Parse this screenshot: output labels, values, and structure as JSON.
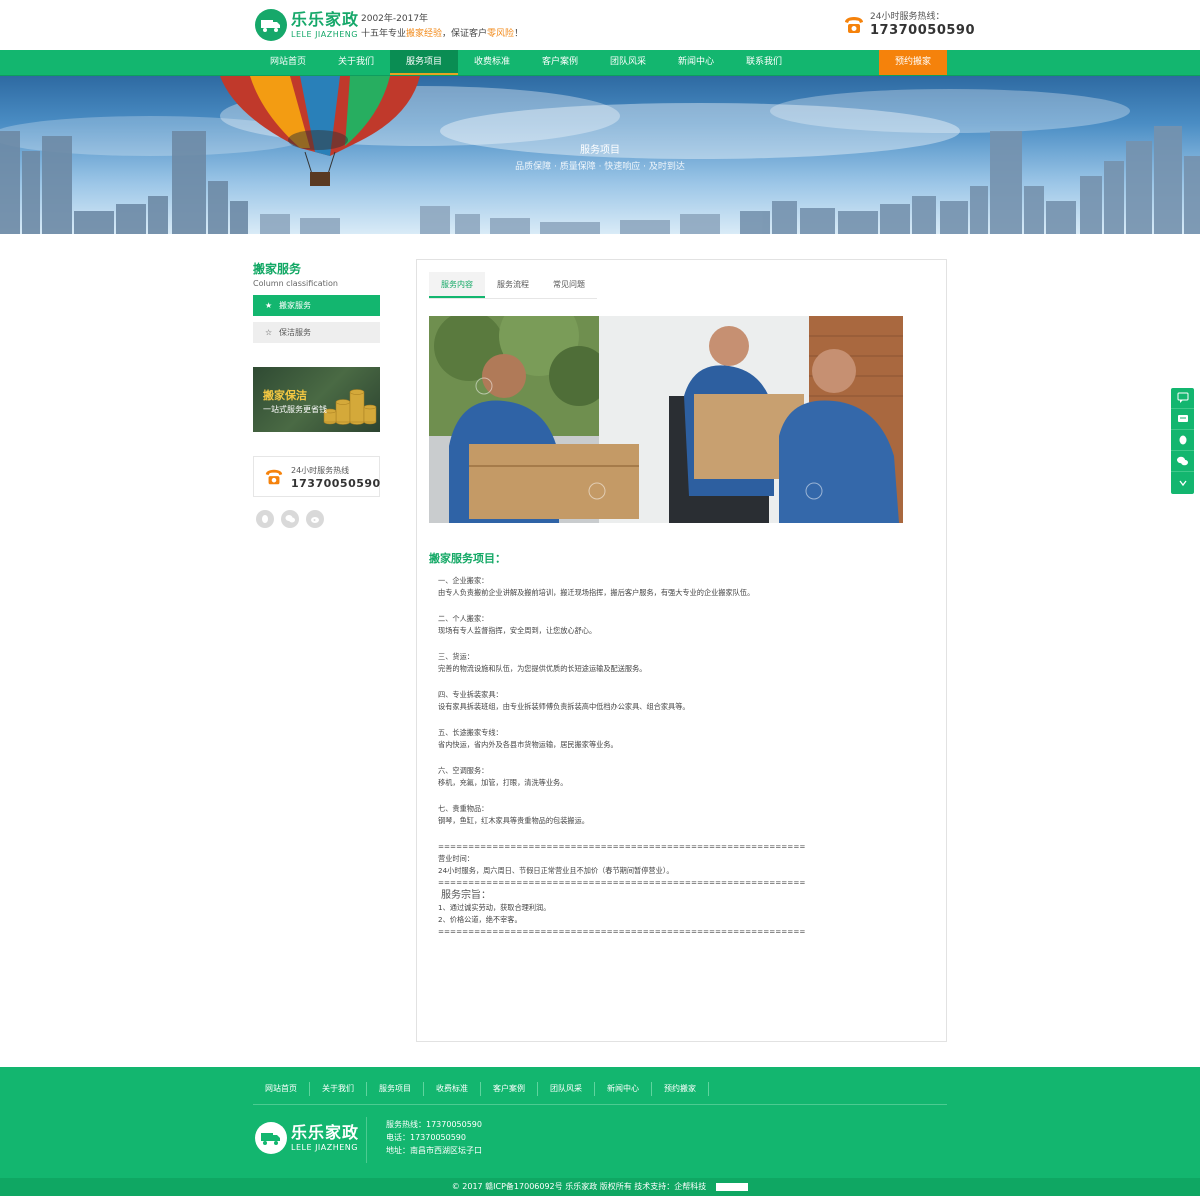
{
  "brand": {
    "name_cn": "乐乐家政",
    "name_en": "LELE JIAZHENG",
    "years": "2002年-2017年",
    "slogan_prefix": "十五年专业",
    "slogan_hl1": "搬家经验",
    "slogan_mid": "，保证客户",
    "slogan_hl2": "零风险",
    "slogan_end": "！"
  },
  "hotline": {
    "label": "24小时服务热线：",
    "number": "17370050590"
  },
  "nav": {
    "items": [
      "网站首页",
      "关于我们",
      "服务项目",
      "收费标准",
      "客户案例",
      "团队风采",
      "新闻中心",
      "联系我们"
    ],
    "active": "服务项目",
    "cta": "预约搬家"
  },
  "banner": {
    "title": "服务项目",
    "subtitle": "品质保障 · 质量保障 · 快速响应 · 及时到达"
  },
  "sidebar": {
    "title": "搬家服务",
    "subtitle": "Column classification",
    "items": [
      {
        "star": "★",
        "label": "搬家服务"
      },
      {
        "star": "☆",
        "label": "保洁服务"
      }
    ],
    "promo_title": "搬家保洁",
    "promo_sub": "一站式服务更省钱",
    "hot_label": "24小时服务热线",
    "hot_number": "17370050590"
  },
  "tabs": [
    "服务内容",
    "服务流程",
    "常见问题"
  ],
  "content": {
    "title": "搬家服务项目：",
    "blocks": [
      [
        "一、企业搬家：",
        "由专人负责搬前企业讲解及搬前培训，搬迁现场指挥，搬后客户服务，有强大专业的企业搬家队伍。"
      ],
      [
        "二、个人搬家：",
        "现场有专人监督指挥，安全周到，让您放心舒心。"
      ],
      [
        "三、货运：",
        "完善的物流设施和队伍，为您提供优质的长短途运输及配送服务。"
      ],
      [
        "四、专业拆装家具：",
        "设有家具拆装班组，由专业拆装师傅负责拆装高中低档办公家具、组合家具等。"
      ],
      [
        "五、长途搬家专线：",
        "省内快运，省内外及各县市货物运输，居民搬家等业务。"
      ],
      [
        "六、空调服务：",
        "移机，充氟，加管，打眼，清洗等业务。"
      ],
      [
        "七、贵重物品：",
        "钢琴，鱼缸，红木家具等贵重物品的包装搬运。"
      ]
    ],
    "separator": "=============================================================",
    "hours_label": "营业时间：",
    "hours_text": "24小时服务，周六周日、节假日正常营业且不加价（春节期间暂停营业）。",
    "tenet_title": "服务宗旨：",
    "tenets": [
      "1、通过诚实劳动，获取合理利润。",
      "2、价格公道，绝不宰客。"
    ]
  },
  "footer": {
    "nav": [
      "网站首页",
      "关于我们",
      "服务项目",
      "收费标准",
      "客户案例",
      "团队风采",
      "新闻中心",
      "预约搬家"
    ],
    "hotline": "服务热线：17370050590",
    "phone": "电话：17370050590",
    "address": "地址：南昌市西湖区坛子口",
    "copyright": "© 2017 赣ICP备17006092号 乐乐家政 版权所有  技术支持：企帮科技"
  },
  "colors": {
    "primary": "#13b66f",
    "accent": "#f5820b",
    "highlight": "#f28a1a"
  },
  "icons": [
    "phone-icon",
    "qq-icon",
    "wechat-icon",
    "weibo-icon",
    "chat-icon",
    "chevron-down-icon"
  ]
}
